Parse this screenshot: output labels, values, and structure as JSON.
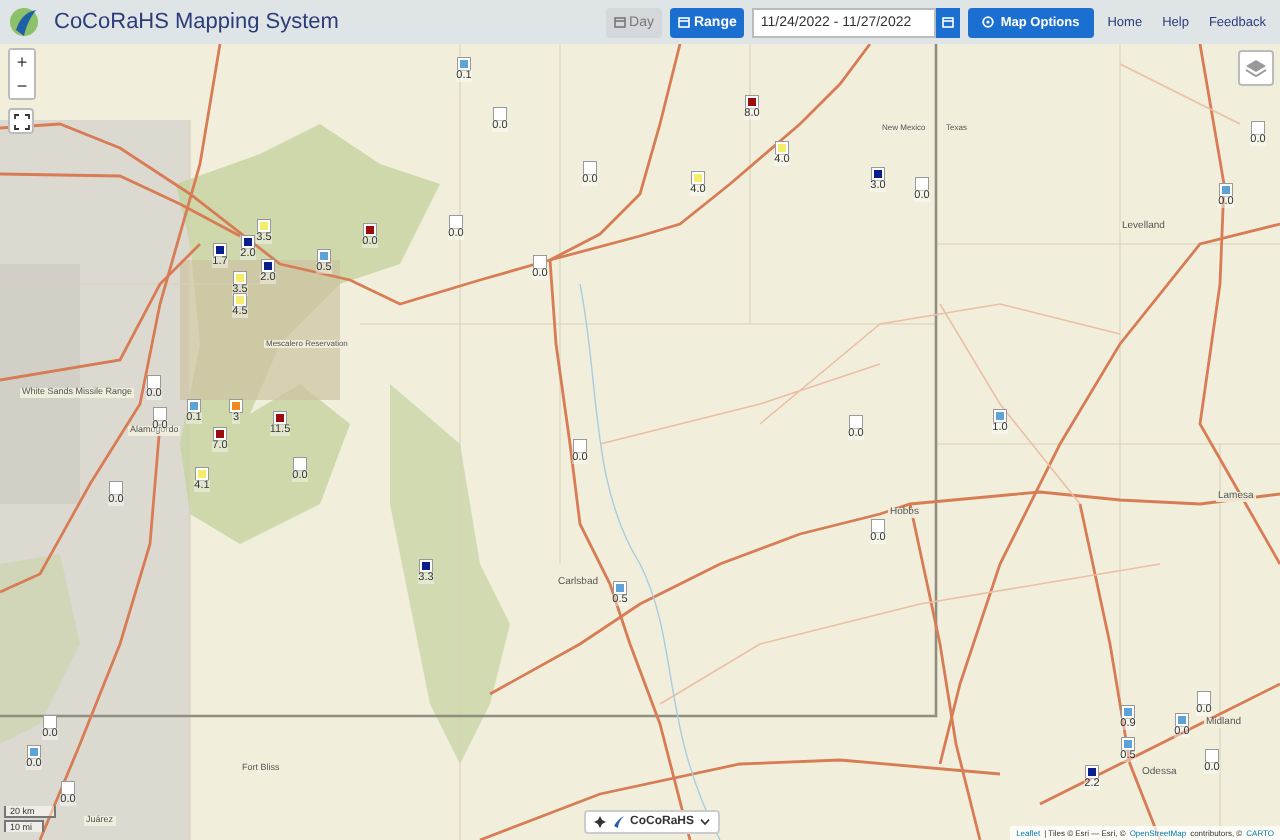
{
  "header": {
    "title": "CoCoRaHS Mapping System",
    "mode_buttons": [
      {
        "label": "Day",
        "selected": false
      },
      {
        "label": "Range",
        "selected": true
      }
    ],
    "date_range": "11/24/2022 - 11/27/2022",
    "options_button": "Map Options",
    "links": [
      "Home",
      "Help",
      "Feedback"
    ]
  },
  "map": {
    "zoom_in": "+",
    "zoom_out": "−",
    "places": [
      "White Sands Missile Range",
      "Alamogordo",
      "Carlsbad",
      "Hobbs",
      "Levelland",
      "Lamesa",
      "Midland",
      "Odessa",
      "Fort Bliss",
      "Juárez",
      "New Mexico",
      "Texas",
      "Mescalero Reservation"
    ],
    "stations": [
      {
        "value": "0.1",
        "color": "#5fa3d6"
      },
      {
        "value": "0.0",
        "color": "#ffffff"
      },
      {
        "value": "0.0",
        "color": "#ffffff"
      },
      {
        "value": "0.0",
        "color": "#9b0d0d"
      },
      {
        "value": "0.0",
        "color": "#ffffff"
      },
      {
        "value": "3.5",
        "color": "#f4ec6a"
      },
      {
        "value": "2.0",
        "color": "#0a1e8c"
      },
      {
        "value": "1.7",
        "color": "#0a1e8c"
      },
      {
        "value": "0.5",
        "color": "#5fa3d6"
      },
      {
        "value": "2.0",
        "color": "#0a1e8c"
      },
      {
        "value": "3.5",
        "color": "#f4ec6a"
      },
      {
        "value": "4.5",
        "color": "#f4ec6a"
      },
      {
        "value": "0.0",
        "color": "#ffffff"
      },
      {
        "value": "0.0",
        "color": "#ffffff"
      },
      {
        "value": "0.0",
        "color": "#ffffff"
      },
      {
        "value": "0.1",
        "color": "#5fa3d6"
      },
      {
        "value": "3",
        "color": "#f08a1c"
      },
      {
        "value": "7.0",
        "color": "#9b0d0d"
      },
      {
        "value": "11.5",
        "color": "#9b0d0d"
      },
      {
        "value": "0.0",
        "color": "#ffffff"
      },
      {
        "value": "4.1",
        "color": "#f4ec6a"
      },
      {
        "value": "0.0",
        "color": "#ffffff"
      },
      {
        "value": "0.0",
        "color": "#ffffff"
      },
      {
        "value": "3.3",
        "color": "#0a1e8c"
      },
      {
        "value": "0.5",
        "color": "#5fa3d6"
      },
      {
        "value": "8.0",
        "color": "#9b0d0d"
      },
      {
        "value": "4.0",
        "color": "#f4ec6a"
      },
      {
        "value": "4.0",
        "color": "#f4ec6a"
      },
      {
        "value": "3.0",
        "color": "#0a1e8c"
      },
      {
        "value": "0.0",
        "color": "#ffffff"
      },
      {
        "value": "0.0",
        "color": "#ffffff"
      },
      {
        "value": "0.0",
        "color": "#5fa3d6"
      },
      {
        "value": "0.0",
        "color": "#ffffff"
      },
      {
        "value": "1.0",
        "color": "#5fa3d6"
      },
      {
        "value": "0.0",
        "color": "#ffffff"
      },
      {
        "value": "0.9",
        "color": "#5fa3d6"
      },
      {
        "value": "0.5",
        "color": "#5fa3d6"
      },
      {
        "value": "2.2",
        "color": "#0a1e8c"
      },
      {
        "value": "0.0",
        "color": "#5fa3d6"
      },
      {
        "value": "0.0",
        "color": "#ffffff"
      },
      {
        "value": "0.0",
        "color": "#ffffff"
      },
      {
        "value": "0.0",
        "color": "#ffffff"
      },
      {
        "value": "0.0",
        "color": "#5fa3d6"
      },
      {
        "value": "0.0",
        "color": "#ffffff"
      }
    ],
    "scale": [
      "20 km",
      "10 mi"
    ],
    "layer_selector": "CoCoRaHS",
    "attribution": {
      "leaflet": "Leaflet",
      "tiles": "| Tiles © Esri — Esri, ©",
      "osm": "OpenStreetMap",
      "contributors": "contributors, ©",
      "carto": "CARTO"
    }
  }
}
